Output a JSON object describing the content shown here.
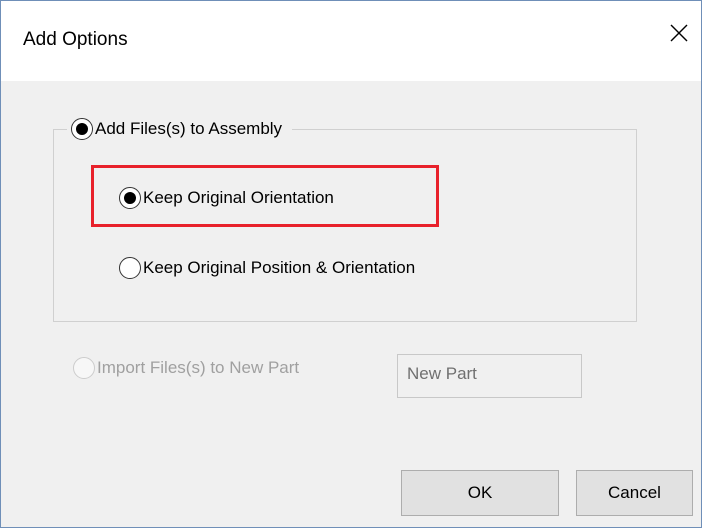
{
  "window": {
    "title": "Add Options",
    "close_icon": "close-icon"
  },
  "group": {
    "label": "Add Files(s) to Assembly",
    "selected": true,
    "options": [
      {
        "label": "Keep Original Orientation",
        "selected": true,
        "highlighted": true
      },
      {
        "label": "Keep Original Position & Orientation",
        "selected": false,
        "highlighted": false
      }
    ]
  },
  "import": {
    "label": "Import Files(s) to New Part",
    "selected": false,
    "enabled": false,
    "part_name": "New Part"
  },
  "buttons": {
    "ok": "OK",
    "cancel": "Cancel"
  },
  "colors": {
    "highlight": "#e8212b",
    "dialog_background": "#f0f0f0",
    "disabled_text": "#a0a0a0"
  }
}
